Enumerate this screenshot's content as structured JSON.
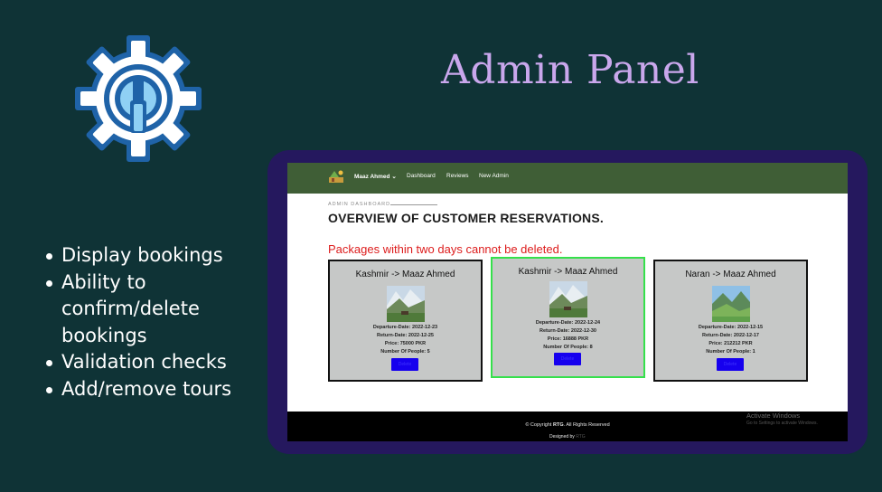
{
  "slide": {
    "title": "Admin Panel",
    "icon": "gear-wrench-icon",
    "colors": {
      "background": "#0f3336",
      "title": "#c9a7ec",
      "frame": "#25185e"
    },
    "bullets": [
      "Display bookings",
      "Ability to confirm/delete bookings",
      "Validation checks",
      "Add/remove tours"
    ]
  },
  "site": {
    "nav": {
      "logo": "travel-logo-icon",
      "user_label": "Maaz Ahmed",
      "items": [
        "Dashboard",
        "Reviews",
        "New Admin"
      ]
    },
    "section_label": "ADMIN DASHBOARD",
    "title": "OVERVIEW OF CUSTOMER RESERVATIONS.",
    "warning": "Packages within two days cannot be deleted.",
    "cards": [
      {
        "title": "Kashmir -> Maaz Ahmed",
        "departure": "Departure-Date: 2022-12-23",
        "return": "Return-Date: 2022-12-25",
        "price": "Price: 75000 PKR",
        "people": "Number Of People: 5",
        "button": "Delete"
      },
      {
        "title": "Kashmir -> Maaz Ahmed",
        "departure": "Departure-Date: 2022-12-24",
        "return": "Return-Date: 2022-12-30",
        "price": "Price: 16888 PKR",
        "people": "Number Of People: 8",
        "button": "Delete"
      },
      {
        "title": "Naran -> Maaz Ahmed",
        "departure": "Departure-Date: 2022-12-15",
        "return": "Return-Date: 2022-12-17",
        "price": "Price: 212212 PKR",
        "people": "Number Of People: 1",
        "button": "Delete"
      }
    ],
    "footer": {
      "copyright_prefix": "© Copyright ",
      "copyright_brand": "RTG",
      "copyright_suffix": ". All Rights Reserved",
      "designed_by": "Designed by",
      "designed_name": "RTG"
    },
    "watermark": {
      "line1": "Activate Windows",
      "line2": "Go to Settings to activate Windows."
    },
    "colors": {
      "navbar": "#3f5e36",
      "card": "#c6c8c7",
      "highlight": "#35e04b",
      "button": "#1600ee",
      "warning": "#dd1c1c"
    }
  }
}
